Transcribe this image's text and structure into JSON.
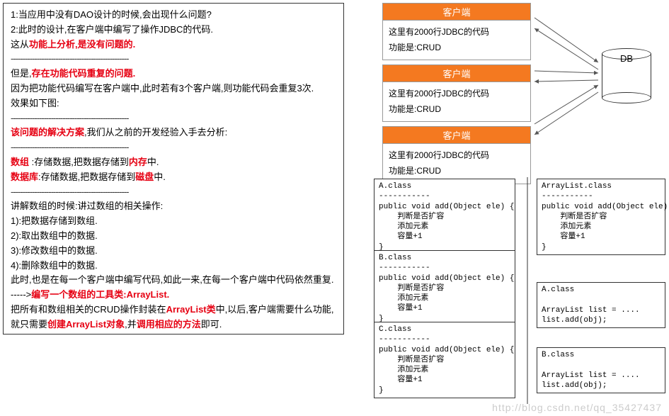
{
  "left": {
    "l1": "1:当应用中没有DAO设计的时候,会出现什么问题?",
    "l2": "2:此时的设计,在客户端中编写了操作JDBC的代码.",
    "l3a": "这从",
    "l3b": "功能上分析,是没有问题的.",
    "l4a": "但是,",
    "l4b": "存在功能代码重复的问题.",
    "l5": "因为把功能代码编写在客户端中,此时若有3个客户端,则功能代码会重复3次.",
    "l6": "效果如下图:",
    "l7a": "该问题的解决方案",
    "l7b": ",我们从之前的开发经验入手去分析:",
    "l8a": "数组",
    "l8b": "   :存储数据,把数据存储到",
    "l8c": "内存",
    "l8d": "中.",
    "l9a": "数据库",
    "l9b": ":存储数据,把数据存储到",
    "l9c": "磁盘",
    "l9d": "中.",
    "l10": "讲解数组的时候:讲过数组的相关操作:",
    "l11": "1):把数据存储到数组.",
    "l12": "2):取出数组中的数据.",
    "l13": "3):修改数组中的数据.",
    "l14": "4):删除数组中的数据.",
    "l15": "此时,也是在每一个客户端中编写代码,如此一来,在每一个客户端中代码依然重复.",
    "l16a": "----->",
    "l16b": "编写一个数组的工具类:ArrayList.",
    "l17a": "把所有和数组相关的CRUD操作封装在",
    "l17b": "ArrayList类",
    "l17c": "中,以后,客户端需要什么功能,就只需要",
    "l17d": "创建ArrayList对象",
    "l17e": ",并",
    "l17f": "调用相应的方法",
    "l17g": "即可.",
    "dash": "--------------------------------------------------"
  },
  "clients": [
    {
      "title": "客户端",
      "line1": "这里有2000行JDBC的代码",
      "line2": "功能是:CRUD"
    },
    {
      "title": "客户端",
      "line1": "这里有2000行JDBC的代码",
      "line2": "功能是:CRUD"
    },
    {
      "title": "客户端",
      "line1": "这里有2000行JDBC的代码",
      "line2": "功能是:CRUD"
    }
  ],
  "db": {
    "label": "DB"
  },
  "code": {
    "A": "A.class\n-----------\npublic void add(Object ele) {\n    判断是否扩容\n    添加元素\n    容量+1\n}",
    "B": "B.class\n-----------\npublic void add(Object ele) {\n    判断是否扩容\n    添加元素\n    容量+1\n}",
    "C": "C.class\n-----------\npublic void add(Object ele) {\n    判断是否扩容\n    添加元素\n    容量+1\n}",
    "ArrayList": "ArrayList.class\n-----------\npublic void add(Object ele) {\n    判断是否扩容\n    添加元素\n    容量+1\n}",
    "A2": "A.class\n\nArrayList list = ....\nlist.add(obj);",
    "B2": "B.class\n\nArrayList list = ....\nlist.add(obj);"
  },
  "watermark": "http://blog.csdn.net/qq_35427437"
}
